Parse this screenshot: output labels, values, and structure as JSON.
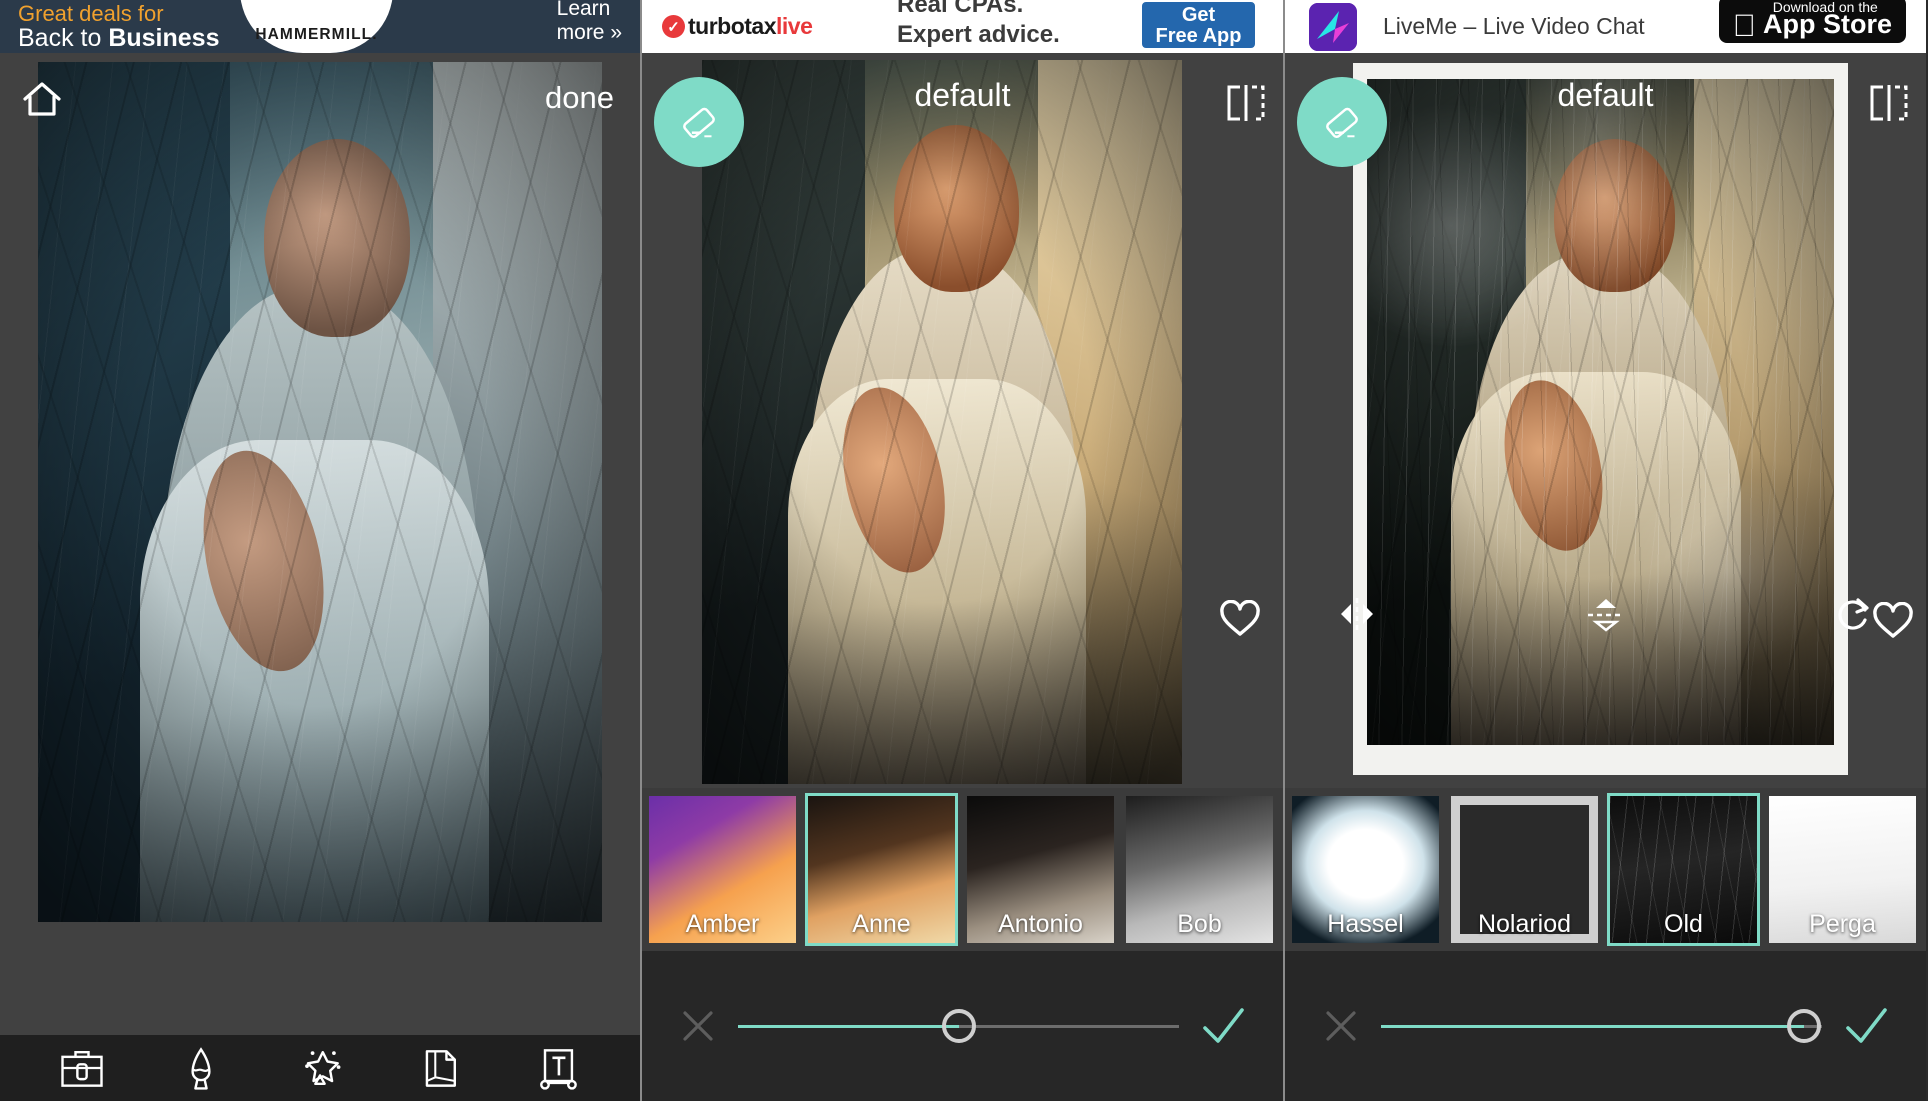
{
  "panels": [
    {
      "id": "panel-editor-home",
      "ad": {
        "type": "hammermill",
        "line1": "Great deals for",
        "line2_prefix": "Back to ",
        "line2_bold": "Business",
        "brand": "HAMMERMILL.",
        "cta_line1": "Learn",
        "cta_line2": "more »"
      },
      "header": {
        "home_icon": "home-icon",
        "done_label": "done"
      },
      "toolbar": [
        {
          "name": "toolbox-icon",
          "label": "Tools"
        },
        {
          "name": "brush-icon",
          "label": "Brush"
        },
        {
          "name": "magic-star-icon",
          "label": "Effects"
        },
        {
          "name": "frame-page-icon",
          "label": "Frames"
        },
        {
          "name": "text-icon",
          "label": "Text"
        }
      ]
    },
    {
      "id": "panel-filters-anne",
      "ad": {
        "type": "turbotax",
        "brand_prefix": "turbotax",
        "brand_suffix": "live",
        "copy_line1": "Real CPAs.",
        "copy_line2": "Expert advice.",
        "button_line1": "Get",
        "button_line2": "Free App"
      },
      "header": {
        "fab_icon": "eraser-icon",
        "title": "default",
        "compare_icon": "compare-split-icon"
      },
      "overlay": {
        "favorite_icon": "heart-icon"
      },
      "filters": [
        {
          "label": "Amber",
          "art": "t-amber",
          "selected": false
        },
        {
          "label": "Anne",
          "art": "t-anne",
          "selected": true
        },
        {
          "label": "Antonio",
          "art": "t-antonio",
          "selected": false
        },
        {
          "label": "Bob",
          "art": "t-bob",
          "selected": false
        }
      ],
      "slider": {
        "value": 50,
        "cancel_icon": "close-x-icon",
        "confirm_icon": "check-icon",
        "fill_color": "#7fdbc7"
      }
    },
    {
      "id": "panel-frames-old",
      "ad": {
        "type": "liveme",
        "app_name": "LiveMe – Live Video Chat",
        "store_small": "Download on the",
        "store_big": "App Store",
        "app_icon": "liveme-app-icon"
      },
      "header": {
        "fab_icon": "eraser-icon",
        "title": "default",
        "compare_icon": "compare-split-icon"
      },
      "overlay": {
        "flip_horizontal_icon": "flip-horizontal-icon",
        "flip_vertical_icon": "flip-vertical-icon",
        "rotate_icon": "rotate-cw-icon",
        "favorite_icon": "heart-icon"
      },
      "filters": [
        {
          "label": "Hassel",
          "art": "t-hassel",
          "selected": false
        },
        {
          "label": "Nolariod",
          "art": "t-nolariod",
          "selected": false
        },
        {
          "label": "Old",
          "art": "t-old",
          "selected": true
        },
        {
          "label": "Perga",
          "art": "t-perga",
          "selected": false
        }
      ],
      "slider": {
        "value": 96,
        "cancel_icon": "close-x-icon",
        "confirm_icon": "check-icon",
        "fill_color": "#7fdbc7"
      }
    }
  ],
  "theme": {
    "accent_teal": "#7fdbc7",
    "panel_background": "#414141",
    "strip_background": "#3b3b3b",
    "toolbar_background": "#1f1f1f",
    "slider_background": "#272727"
  }
}
